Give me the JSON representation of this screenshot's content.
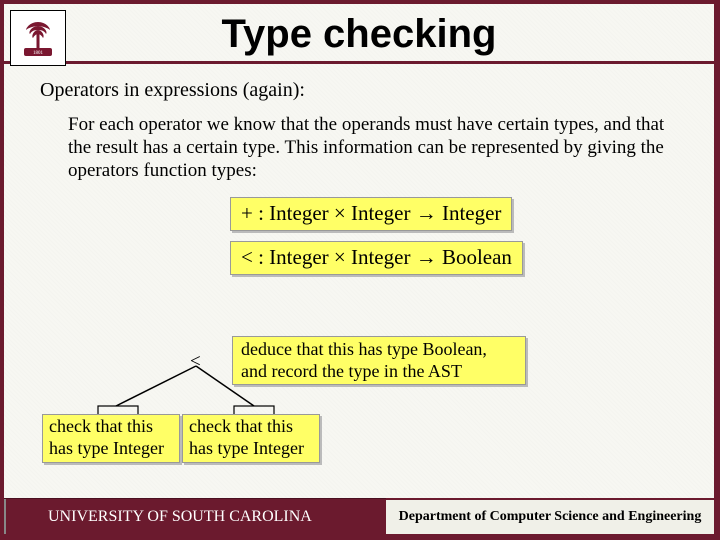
{
  "title": "Type checking",
  "subhead": "Operators in expressions (again):",
  "body": "For each operator we know that the operands must have certain types, and that the result has a certain type. This information can be represented by giving the operators function types:",
  "sig_plus": "+ : Integer × Integer → Integer",
  "sig_lt": "< : Integer × Integer → Boolean",
  "deduce": "deduce that this has type Boolean, and record the type in the AST",
  "lt_symbol": "<",
  "check_left": "check that this has type Integer",
  "check_right": "check that this has type Integer",
  "footer_left": "UNIVERSITY OF SOUTH CAROLINA",
  "footer_right": "Department of Computer Science and Engineering"
}
